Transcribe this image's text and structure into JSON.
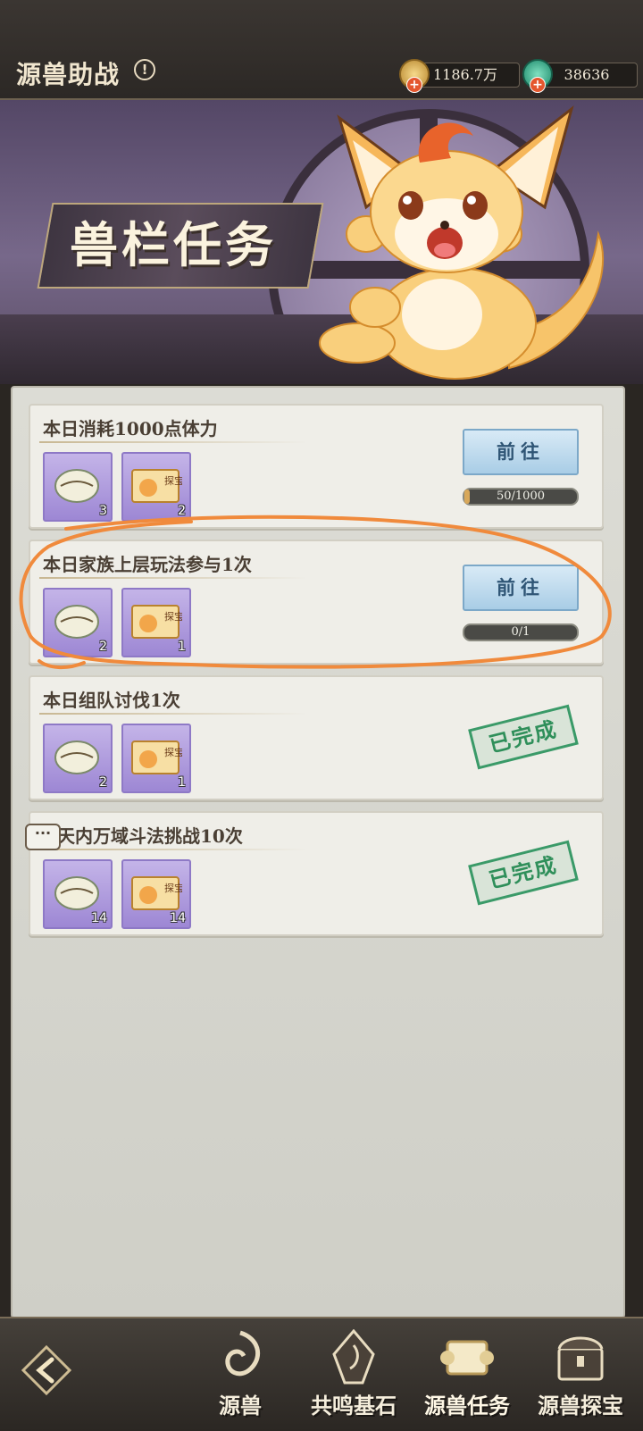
{
  "header": {
    "title": "源兽助战",
    "info_icon": "info-icon",
    "coins": "1186.7万",
    "gems": "38636"
  },
  "banner": {
    "title": "兽栏任务"
  },
  "tasks": [
    {
      "title": "本日消耗1000点体力",
      "reward1": "3",
      "reward2": "2",
      "status": "progress",
      "button": "前往",
      "progress_text": "50/1000",
      "progress": 0.05
    },
    {
      "title": "本日家族上层玩法参与1次",
      "reward1": "2",
      "reward2": "1",
      "status": "progress",
      "button": "前往",
      "progress_text": "0/1",
      "progress": 0
    },
    {
      "title": "本日组队讨伐1次",
      "reward1": "2",
      "reward2": "1",
      "status": "done",
      "done_label": "已完成"
    },
    {
      "title": "天内万域斗法挑战10次",
      "reward1": "14",
      "reward2": "14",
      "status": "done",
      "done_label": "已完成"
    }
  ],
  "reward_ticket_label": "探宝",
  "chat_icon": "···",
  "nav": {
    "back_icon": "back-arrow-icon",
    "items": [
      {
        "label": "源兽",
        "active": false
      },
      {
        "label": "共鸣基石",
        "active": false
      },
      {
        "label": "源兽任务",
        "active": true
      },
      {
        "label": "源兽探宝",
        "active": false
      }
    ]
  },
  "colors": {
    "annotation": "#f08a3c",
    "done_stamp": "#2f8f5a",
    "button_bg": "#a9cde6"
  }
}
